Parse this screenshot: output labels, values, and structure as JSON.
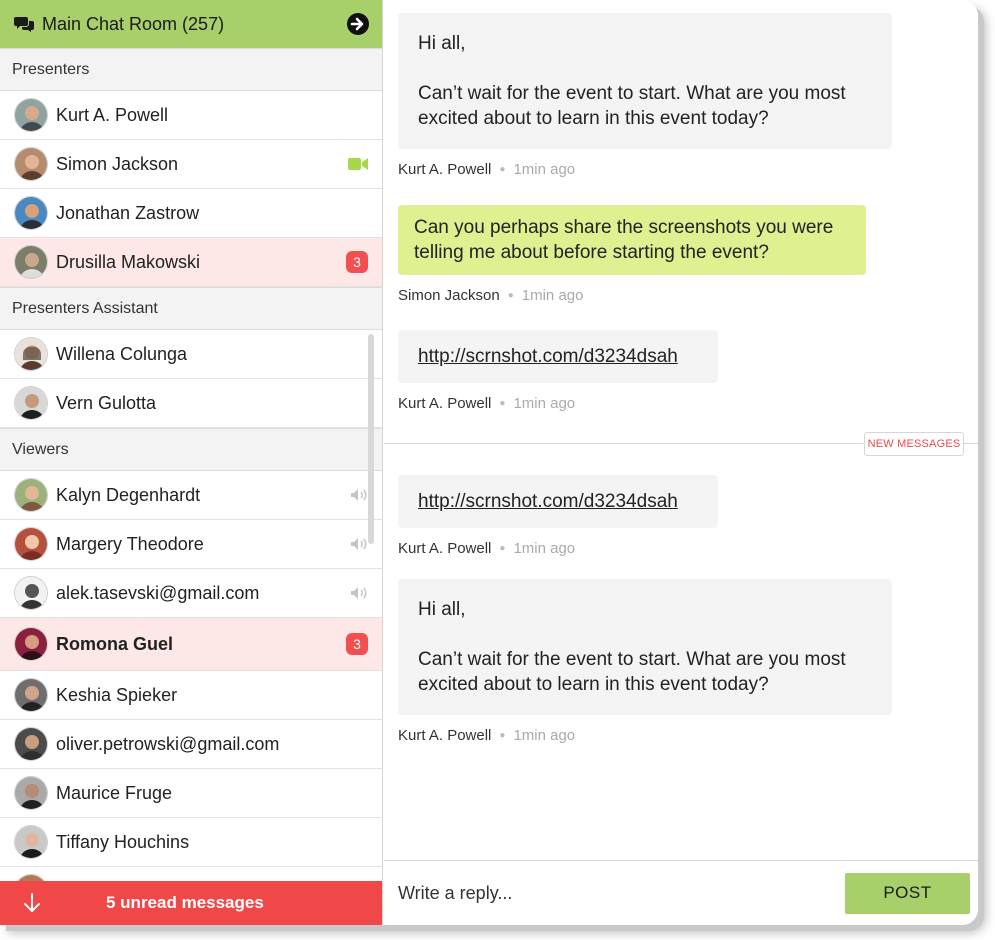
{
  "room": {
    "title": "Main Chat Room (257)"
  },
  "sections": {
    "presenters": "Presenters",
    "assistant": "Presenters Assistant",
    "viewers": "Viewers"
  },
  "presenters": [
    {
      "name": "Kurt A. Powell"
    },
    {
      "name": "Simon Jackson",
      "icon": "video-camera-icon"
    },
    {
      "name": "Jonathan Zastrow"
    },
    {
      "name": "Drusilla Makowski",
      "badge": "3"
    }
  ],
  "assistants": [
    {
      "name": "Willena Colunga"
    },
    {
      "name": "Vern Gulotta"
    }
  ],
  "viewers": [
    {
      "name": "Kalyn Degenhardt",
      "icon": "speaker-icon"
    },
    {
      "name": "Margery Theodore",
      "icon": "speaker-icon"
    },
    {
      "name": "alek.tasevski@gmail.com",
      "icon": "speaker-icon"
    },
    {
      "name": "Romona Guel",
      "badge": "3"
    },
    {
      "name": "Keshia Spieker"
    },
    {
      "name": "oliver.petrowski@gmail.com"
    },
    {
      "name": "Maurice Fruge"
    },
    {
      "name": "Tiffany Houchins"
    }
  ],
  "unread": {
    "label": "5 unread messages"
  },
  "messages": [
    {
      "line1": "Hi all,",
      "line2": "Can’t wait for the event to start. What are you most",
      "line3": "excited about to learn in this event today?",
      "author": "Kurt A. Powell",
      "time": "1min ago"
    },
    {
      "line1": "Can you perhaps share the screenshots you were",
      "line2": "telling me about before starting the event?",
      "author": "Simon Jackson",
      "time": "1min ago"
    },
    {
      "link": "http://scrnshot.com/d3234dsah",
      "author": "Kurt A. Powell",
      "time": "1min ago"
    },
    {
      "link": "http://scrnshot.com/d3234dsah",
      "author": "Kurt A. Powell",
      "time": "1min ago"
    },
    {
      "line1": "Hi all,",
      "line2": "Can’t wait for the event to start. What are you most",
      "line3": "excited about to learn in this event today?",
      "author": "Kurt A. Powell",
      "time": "1min ago"
    }
  ],
  "new_messages_label": "NEW MESSAGES",
  "composer": {
    "placeholder": "Write a reply...",
    "post_label": "POST"
  },
  "colors": {
    "accent_green": "#a7cf6a",
    "bubble_green": "#def08f",
    "alert_red": "#f04848",
    "highlight_pink": "#fde7e7"
  }
}
